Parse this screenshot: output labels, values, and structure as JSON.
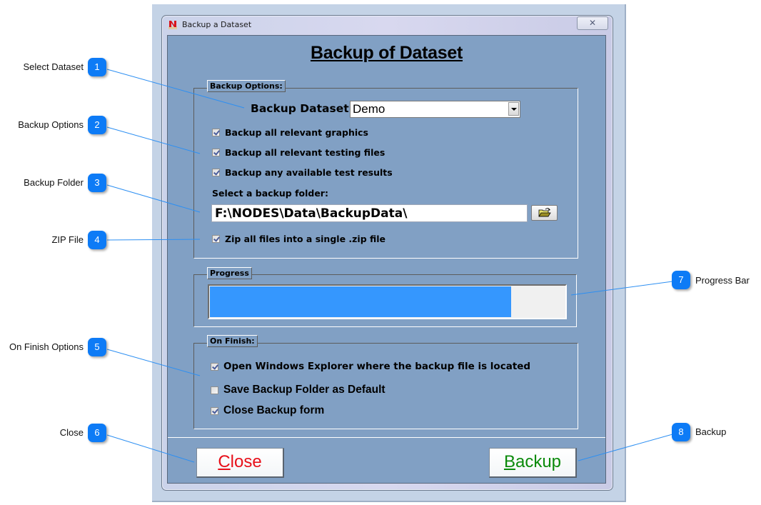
{
  "window": {
    "title": "Backup a Dataset",
    "close_glyph": "✕",
    "app_icon": "nodes-app-icon"
  },
  "form": {
    "heading": "Backup of Dataset",
    "backup_options": {
      "legend": "Backup Options:",
      "dataset_label": "Backup Dataset:",
      "dataset_value": "Demo",
      "checkboxes": [
        {
          "label": "Backup all relevant graphics",
          "checked": true
        },
        {
          "label": "Backup all relevant testing files",
          "checked": true
        },
        {
          "label": "Backup any available test results",
          "checked": true
        }
      ],
      "folder_label": "Select a backup folder:",
      "folder_value": "F:\\NODES\\Data\\BackupData\\",
      "browse_icon": "open-folder-icon",
      "zip": {
        "label": "Zip all files into a single .zip file",
        "checked": true
      }
    },
    "progress": {
      "legend": "Progress",
      "value_fraction": 0.85,
      "fill_color": "#3597fe"
    },
    "on_finish": {
      "legend": "On Finish:",
      "checkboxes": [
        {
          "label": "Open Windows Explorer where the backup file is located",
          "checked": true
        },
        {
          "label": "Save Backup Folder as Default",
          "checked": false
        },
        {
          "label": "Close Backup form",
          "checked": true
        }
      ]
    },
    "buttons": {
      "close": {
        "mnemonic": "C",
        "rest": "lose",
        "color": "#e8101a"
      },
      "backup": {
        "mnemonic": "B",
        "rest": "ackup",
        "color": "#0a8a0a"
      }
    }
  },
  "callouts": [
    {
      "number": "1",
      "label": "Select Dataset"
    },
    {
      "number": "2",
      "label": "Backup Options"
    },
    {
      "number": "3",
      "label": "Backup Folder"
    },
    {
      "number": "4",
      "label": "ZIP File"
    },
    {
      "number": "5",
      "label": "On Finish Options"
    },
    {
      "number": "6",
      "label": "Close"
    },
    {
      "number": "7",
      "label": "Progress Bar"
    },
    {
      "number": "8",
      "label": "Backup"
    }
  ],
  "colors": {
    "callout": "#0d7bf6",
    "form_background": "#81a0c4"
  }
}
